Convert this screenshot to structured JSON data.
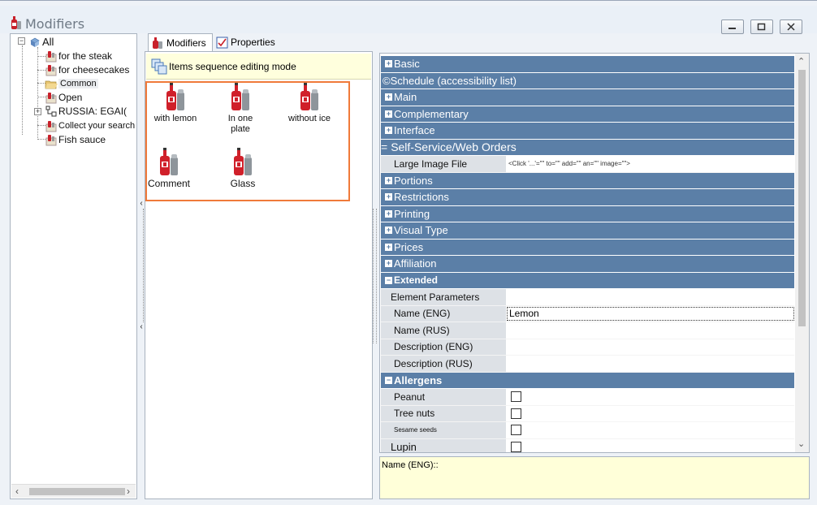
{
  "window": {
    "title": "Modifiers",
    "buttons": [
      "minimize",
      "maximize",
      "close"
    ]
  },
  "tree": {
    "root": "All",
    "nodes": [
      {
        "label": "for the steak"
      },
      {
        "label": "for cheesecakes"
      },
      {
        "label": "Common"
      },
      {
        "label": "Open"
      },
      {
        "label": "RUSSIA: EGAI("
      },
      {
        "label": "Collect your search"
      },
      {
        "label": "Fish sauce"
      }
    ]
  },
  "tabs": [
    {
      "label": "Modifiers",
      "icon": "modifier-bottle-icon"
    },
    {
      "label": "Properties",
      "icon": "properties-icon"
    }
  ],
  "mode_bar": {
    "label": "Items sequence editing mode",
    "icon": "sequence-mode-icon"
  },
  "items": [
    {
      "label": "with lemon"
    },
    {
      "label": "In one plate"
    },
    {
      "label": "without ice"
    },
    {
      "label": "Comment"
    },
    {
      "label": "Glass"
    }
  ],
  "grid": {
    "categories_top": [
      {
        "label": "Basic",
        "marker": "+"
      },
      {
        "label": "©Schedule (accessibility list)",
        "marker": ""
      },
      {
        "label": "Main",
        "marker": "+"
      },
      {
        "label": "Complementary",
        "marker": "+"
      },
      {
        "label": "Interface",
        "marker": "+"
      },
      {
        "label": "Self-Service/Web Orders",
        "marker": "="
      }
    ],
    "large_image": {
      "name": "Large Image File",
      "value": "<Click '...'=\"\" to=\"\" add=\"\" an=\"\" image=\"\">"
    },
    "categories_mid": [
      {
        "label": "Portions",
        "marker": "+"
      },
      {
        "label": "Restrictions",
        "marker": "+"
      },
      {
        "label": "Printing",
        "marker": "+"
      },
      {
        "label": "Visual Type",
        "marker": "+"
      },
      {
        "label": "Prices",
        "marker": "+"
      },
      {
        "label": "Affiliation",
        "marker": "+"
      },
      {
        "label": "Extended",
        "marker": "−"
      }
    ],
    "element_parameters": "Element Parameters",
    "extended_props": [
      {
        "name": "Name (ENG)",
        "value": "Lemon"
      },
      {
        "name": "Name (RUS)",
        "value": ""
      },
      {
        "name": "Description (ENG)",
        "value": ""
      },
      {
        "name": "Description (RUS)",
        "value": ""
      }
    ],
    "allergens_category": {
      "label": "Allergens",
      "marker": "−"
    },
    "allergens": [
      {
        "name": "Peanut",
        "checked": false
      },
      {
        "name": "Tree nuts",
        "checked": false
      },
      {
        "name": "Sesame seeds",
        "checked": false
      },
      {
        "name": "Lupin",
        "checked": false
      }
    ]
  },
  "description": {
    "text": "Name (ENG)::"
  },
  "colors": {
    "category_bg": "#5b7fa7",
    "highlight_border": "#f07a3a",
    "mode_bar_bg": "#ffffdd",
    "description_bg": "#ffffd9"
  }
}
